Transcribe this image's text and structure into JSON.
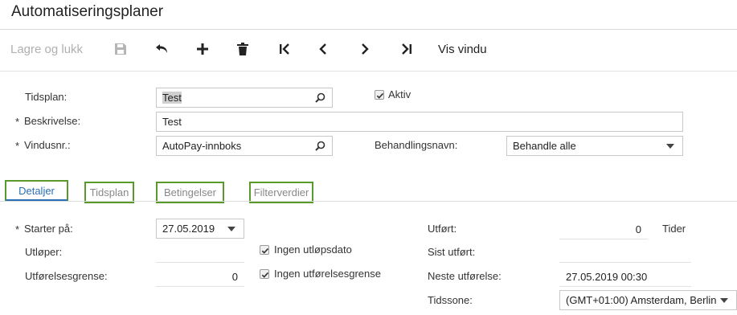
{
  "header": {
    "title": "Automatiseringsplaner"
  },
  "toolbar": {
    "save_close_label": "Lagre og lukk",
    "view_window_label": "Vis vindu"
  },
  "form": {
    "schedule_label": "Tidsplan:",
    "schedule_value": "Test",
    "active_label": "Aktiv",
    "description_label": "Beskrivelse:",
    "description_value": "Test",
    "window_label": "Vindusnr.:",
    "window_value": "AutoPay-innboks",
    "action_label": "Behandlingsnavn:",
    "action_value": "Behandle alle",
    "required_mark": "*"
  },
  "tabs": [
    {
      "label": "Detaljer"
    },
    {
      "label": "Tidsplan"
    },
    {
      "label": "Betingelser"
    },
    {
      "label": "Filterverdier"
    }
  ],
  "details": {
    "starts_label": "Starter på:",
    "starts_value": "27.05.2019",
    "expires_label": "Utløper:",
    "no_expiry_label": "Ingen utløpsdato",
    "exec_limit_label": "Utførelsesgrense:",
    "exec_limit_value": "0",
    "no_exec_limit_label": "Ingen utførelsesgrense",
    "executed_label": "Utført:",
    "executed_value": "0",
    "times_label": "Tider",
    "last_executed_label": "Sist utført:",
    "next_execution_label": "Neste utførelse:",
    "next_execution_value": "27.05.2019 00:30",
    "timezone_label": "Tidssone:",
    "timezone_value": "(GMT+01:00) Amsterdam, Berlin"
  }
}
